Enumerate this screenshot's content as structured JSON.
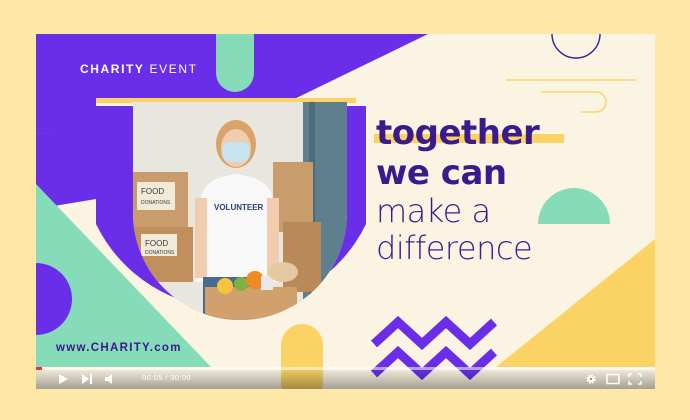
{
  "brand": {
    "word1": "CHARITY",
    "word2": "EVENT"
  },
  "headline": {
    "line1": "together",
    "line2": "we can",
    "line3": "make a",
    "line4": "difference"
  },
  "website": "www.CHARITY.com",
  "photo": {
    "shirt_text": "VOLUNTEER",
    "box1_text1": "FOOD",
    "box1_text2": "DONATIONS",
    "box2_text1": "FOOD",
    "box2_text2": "DONATIONS"
  },
  "player": {
    "current_time": "00:05",
    "separator": "/",
    "duration": "30:00",
    "progress_fraction": 0.003
  },
  "icons": {
    "play": "play-icon",
    "next": "skip-next-icon",
    "volume": "volume-icon",
    "settings": "gear-icon",
    "miniplayer": "miniplayer-icon",
    "fullscreen": "fullscreen-icon"
  },
  "colors": {
    "purple": "#6a2ee8",
    "mint": "#86dcb8",
    "yellow": "#fbd365",
    "navy": "#3a1a8c",
    "cream": "#fbf4e2",
    "background": "#fde8a8"
  }
}
